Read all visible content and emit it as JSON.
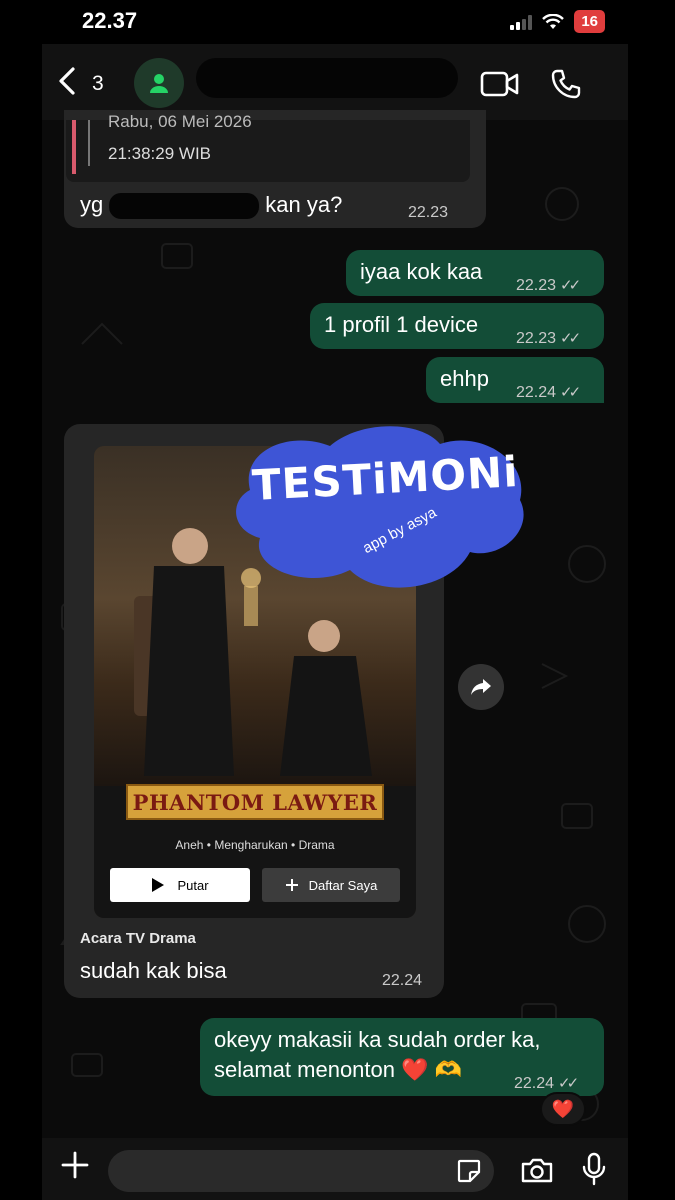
{
  "status": {
    "time": "22.37",
    "battery": "16"
  },
  "header": {
    "back_count": "3"
  },
  "quoted": {
    "date": "Rabu, 06 Mei 2026",
    "time": "21:38:29 WIB"
  },
  "messages": [
    {
      "dir": "in",
      "before": "yg",
      "after": "kan ya?",
      "time": "22.23"
    },
    {
      "dir": "out",
      "text": "iyaa kok kaa",
      "time": "22.23"
    },
    {
      "dir": "out",
      "text": "1 profil 1 device",
      "time": "22.23"
    },
    {
      "dir": "out",
      "text": "ehhp",
      "time": "22.24"
    },
    {
      "dir": "in",
      "caption": "Acara TV Drama",
      "text": "sudah kak bisa",
      "time": "22.24"
    },
    {
      "dir": "out",
      "line1": "okeyy makasii ka sudah order ka,",
      "line2": "selamat menonton ❤️ 🫶",
      "time": "22.24"
    }
  ],
  "poster": {
    "title": "PHANTOM LAWYER",
    "genres": "Aneh • Mengharukan • Drama",
    "play_label": "Putar",
    "list_label": "Daftar Saya"
  },
  "sticker": {
    "title": "TESTiMONi",
    "subtitle": "app by asya"
  },
  "reaction": "❤️",
  "composer": {
    "placeholder": ""
  },
  "icons": {
    "back": "chevron-left-icon",
    "video": "video-call-icon",
    "call": "phone-icon",
    "forward": "forward-icon",
    "plus": "plus-icon",
    "sticker": "sticker-icon",
    "camera": "camera-icon",
    "mic": "mic-icon"
  },
  "colors": {
    "outgoing": "#134d37",
    "incoming": "#262626",
    "sticker": "#3e55d6",
    "accent": "#25d366"
  }
}
